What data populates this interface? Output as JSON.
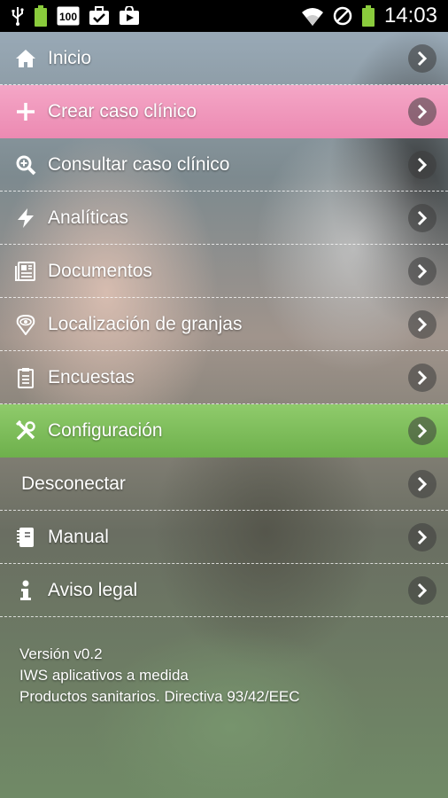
{
  "status_bar": {
    "time": "14:03",
    "left_icons": [
      "usb-icon",
      "battery-full-icon",
      "badge-100-icon",
      "briefcase-check-icon",
      "store-bag-icon"
    ],
    "badge_text": "100",
    "right_icons": [
      "wifi-icon",
      "blocked-icon",
      "battery-icon"
    ]
  },
  "menu": {
    "items": [
      {
        "label": "Inicio",
        "icon": "home-icon"
      },
      {
        "label": "Crear caso clínico",
        "icon": "plus-icon",
        "accent": "#ef96bb"
      },
      {
        "label": "Consultar caso clínico",
        "icon": "search-zoom-icon"
      },
      {
        "label": "Analíticas",
        "icon": "lightning-icon"
      },
      {
        "label": "Documentos",
        "icon": "document-icon"
      },
      {
        "label": "Localización de granjas",
        "icon": "location-eye-icon"
      },
      {
        "label": "Encuestas",
        "icon": "clipboard-icon"
      },
      {
        "label": "Configuración",
        "icon": "tools-icon",
        "accent": "#7bbd58"
      },
      {
        "label": "Desconectar",
        "icon": ""
      },
      {
        "label": "Manual",
        "icon": "notebook-icon"
      },
      {
        "label": "Aviso legal",
        "icon": "info-icon"
      }
    ]
  },
  "footer": {
    "version": "Versión v0.2",
    "company": "IWS aplicativos a medida",
    "regulation": "Productos sanitarios. Directiva 93/42/EEC"
  }
}
